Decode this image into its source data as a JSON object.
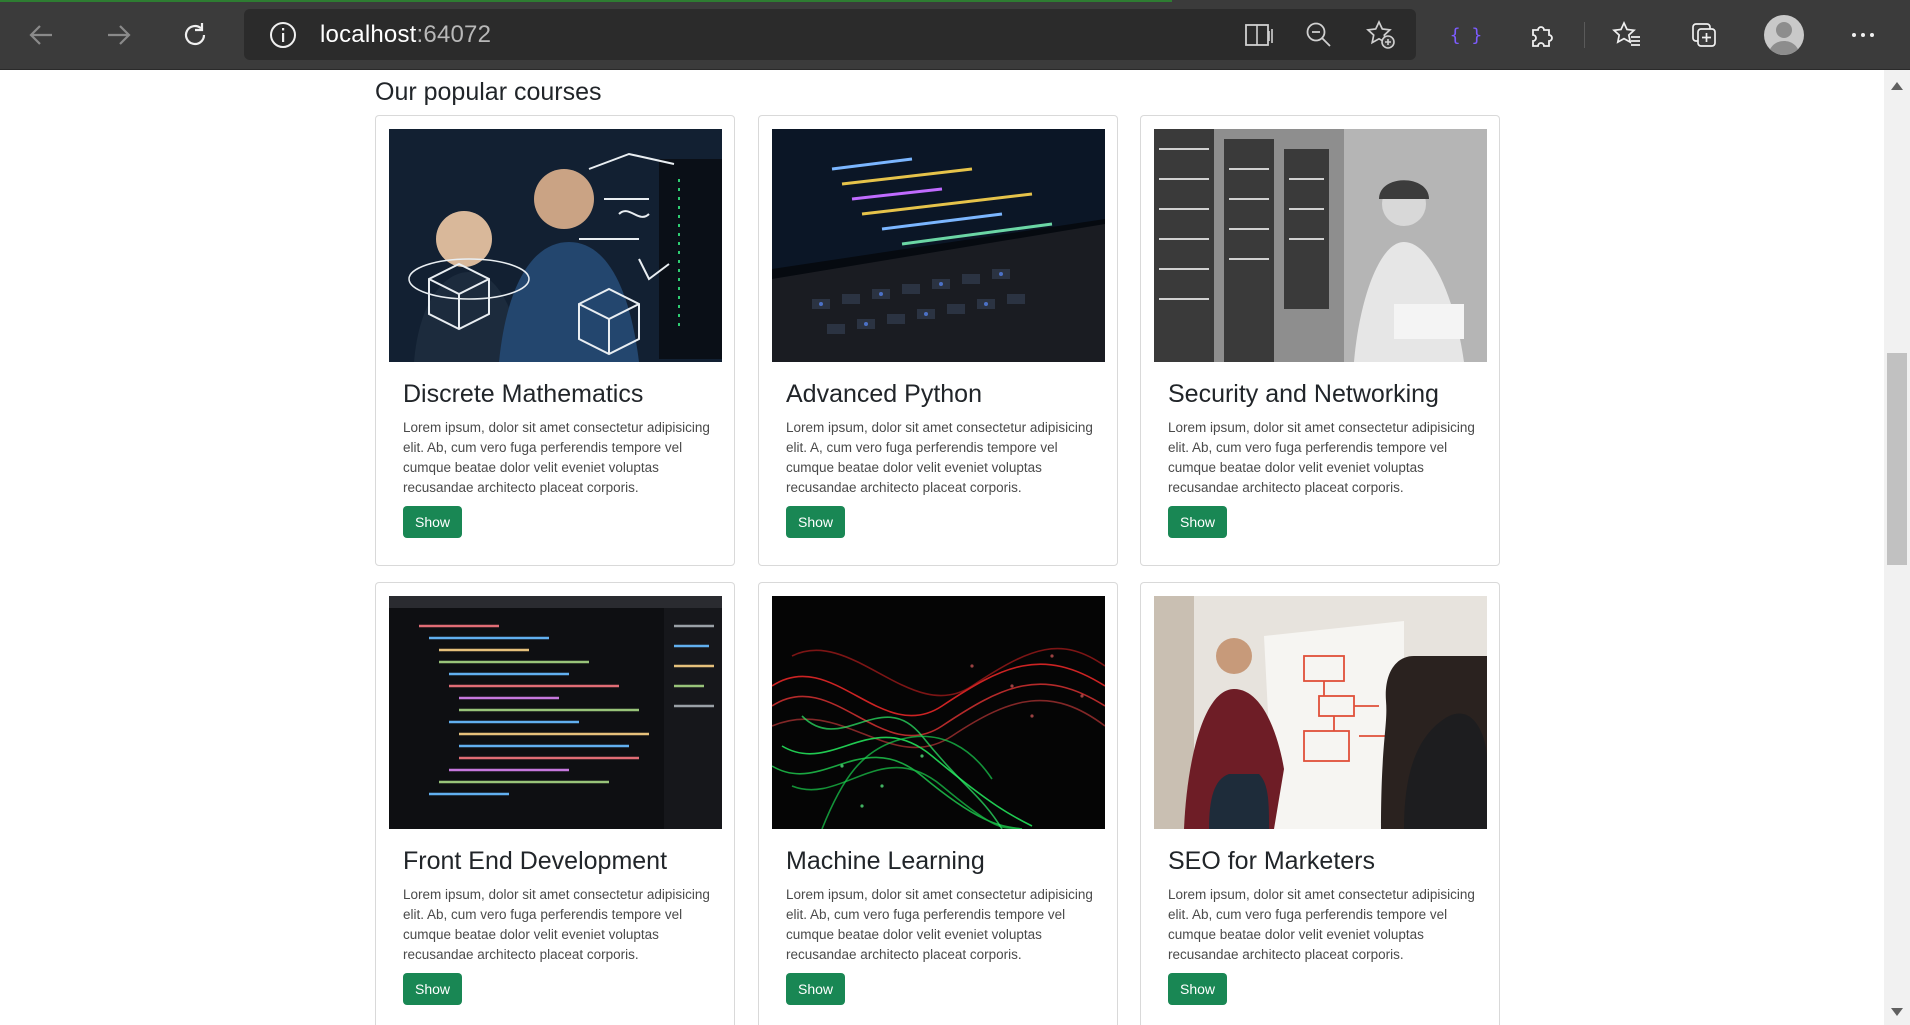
{
  "browser": {
    "url_host": "localhost",
    "url_port": ":64072",
    "icons": {
      "back": "back-arrow-icon",
      "forward": "forward-arrow-icon",
      "reload": "reload-icon",
      "site_info": "info-icon",
      "read_aloud": "read-aloud-icon",
      "zoom": "zoom-out-icon",
      "favorite": "add-favorite-icon",
      "devtools": "braces-extension-icon",
      "extensions": "puzzle-icon",
      "favorites": "favorites-star-icon",
      "collections": "collections-icon",
      "profile": "profile-avatar",
      "menu": "more-menu-icon"
    }
  },
  "page": {
    "section_title": "Our popular courses",
    "accent_color": "#198754",
    "courses": [
      {
        "title": "Discrete Mathematics",
        "description": "Lorem ipsum, dolor sit amet consectetur adipisicing elit. Ab, cum vero fuga perferendis tempore vel cumque beatae dolor velit eveniet voluptas recusandae architecto placeat corporis.",
        "button": "Show",
        "image": "two men writing math equations on glass"
      },
      {
        "title": "Advanced Python",
        "description": "Lorem ipsum, dolor sit amet consectetur adipisicing elit. A, cum vero fuga perferendis tempore vel cumque beatae dolor velit eveniet voluptas recusandae architecto placeat corporis.",
        "button": "Show",
        "image": "laptop keyboard with code on screen"
      },
      {
        "title": "Security and Networking",
        "description": "Lorem ipsum, dolor sit amet consectetur adipisicing elit. Ab, cum vero fuga perferendis tempore vel cumque beatae dolor velit eveniet voluptas recusandae architecto placeat corporis.",
        "button": "Show",
        "image": "woman operating vintage computer"
      },
      {
        "title": "Front End Development",
        "description": "Lorem ipsum, dolor sit amet consectetur adipisicing elit. Ab, cum vero fuga perferendis tempore vel cumque beatae dolor velit eveniet voluptas recusandae architecto placeat corporis.",
        "button": "Show",
        "image": "code editor on dark screen"
      },
      {
        "title": "Machine Learning",
        "description": "Lorem ipsum, dolor sit amet consectetur adipisicing elit. Ab, cum vero fuga perferendis tempore vel cumque beatae dolor velit eveniet voluptas recusandae architecto placeat corporis.",
        "button": "Show",
        "image": "red and green neural mesh"
      },
      {
        "title": "SEO for Marketers",
        "description": "Lorem ipsum, dolor sit amet consectetur adipisicing elit. Ab, cum vero fuga perferendis tempore vel cumque beatae dolor velit eveniet voluptas recusandae architecto placeat corporis.",
        "button": "Show",
        "image": "two people at whiteboard"
      }
    ]
  }
}
